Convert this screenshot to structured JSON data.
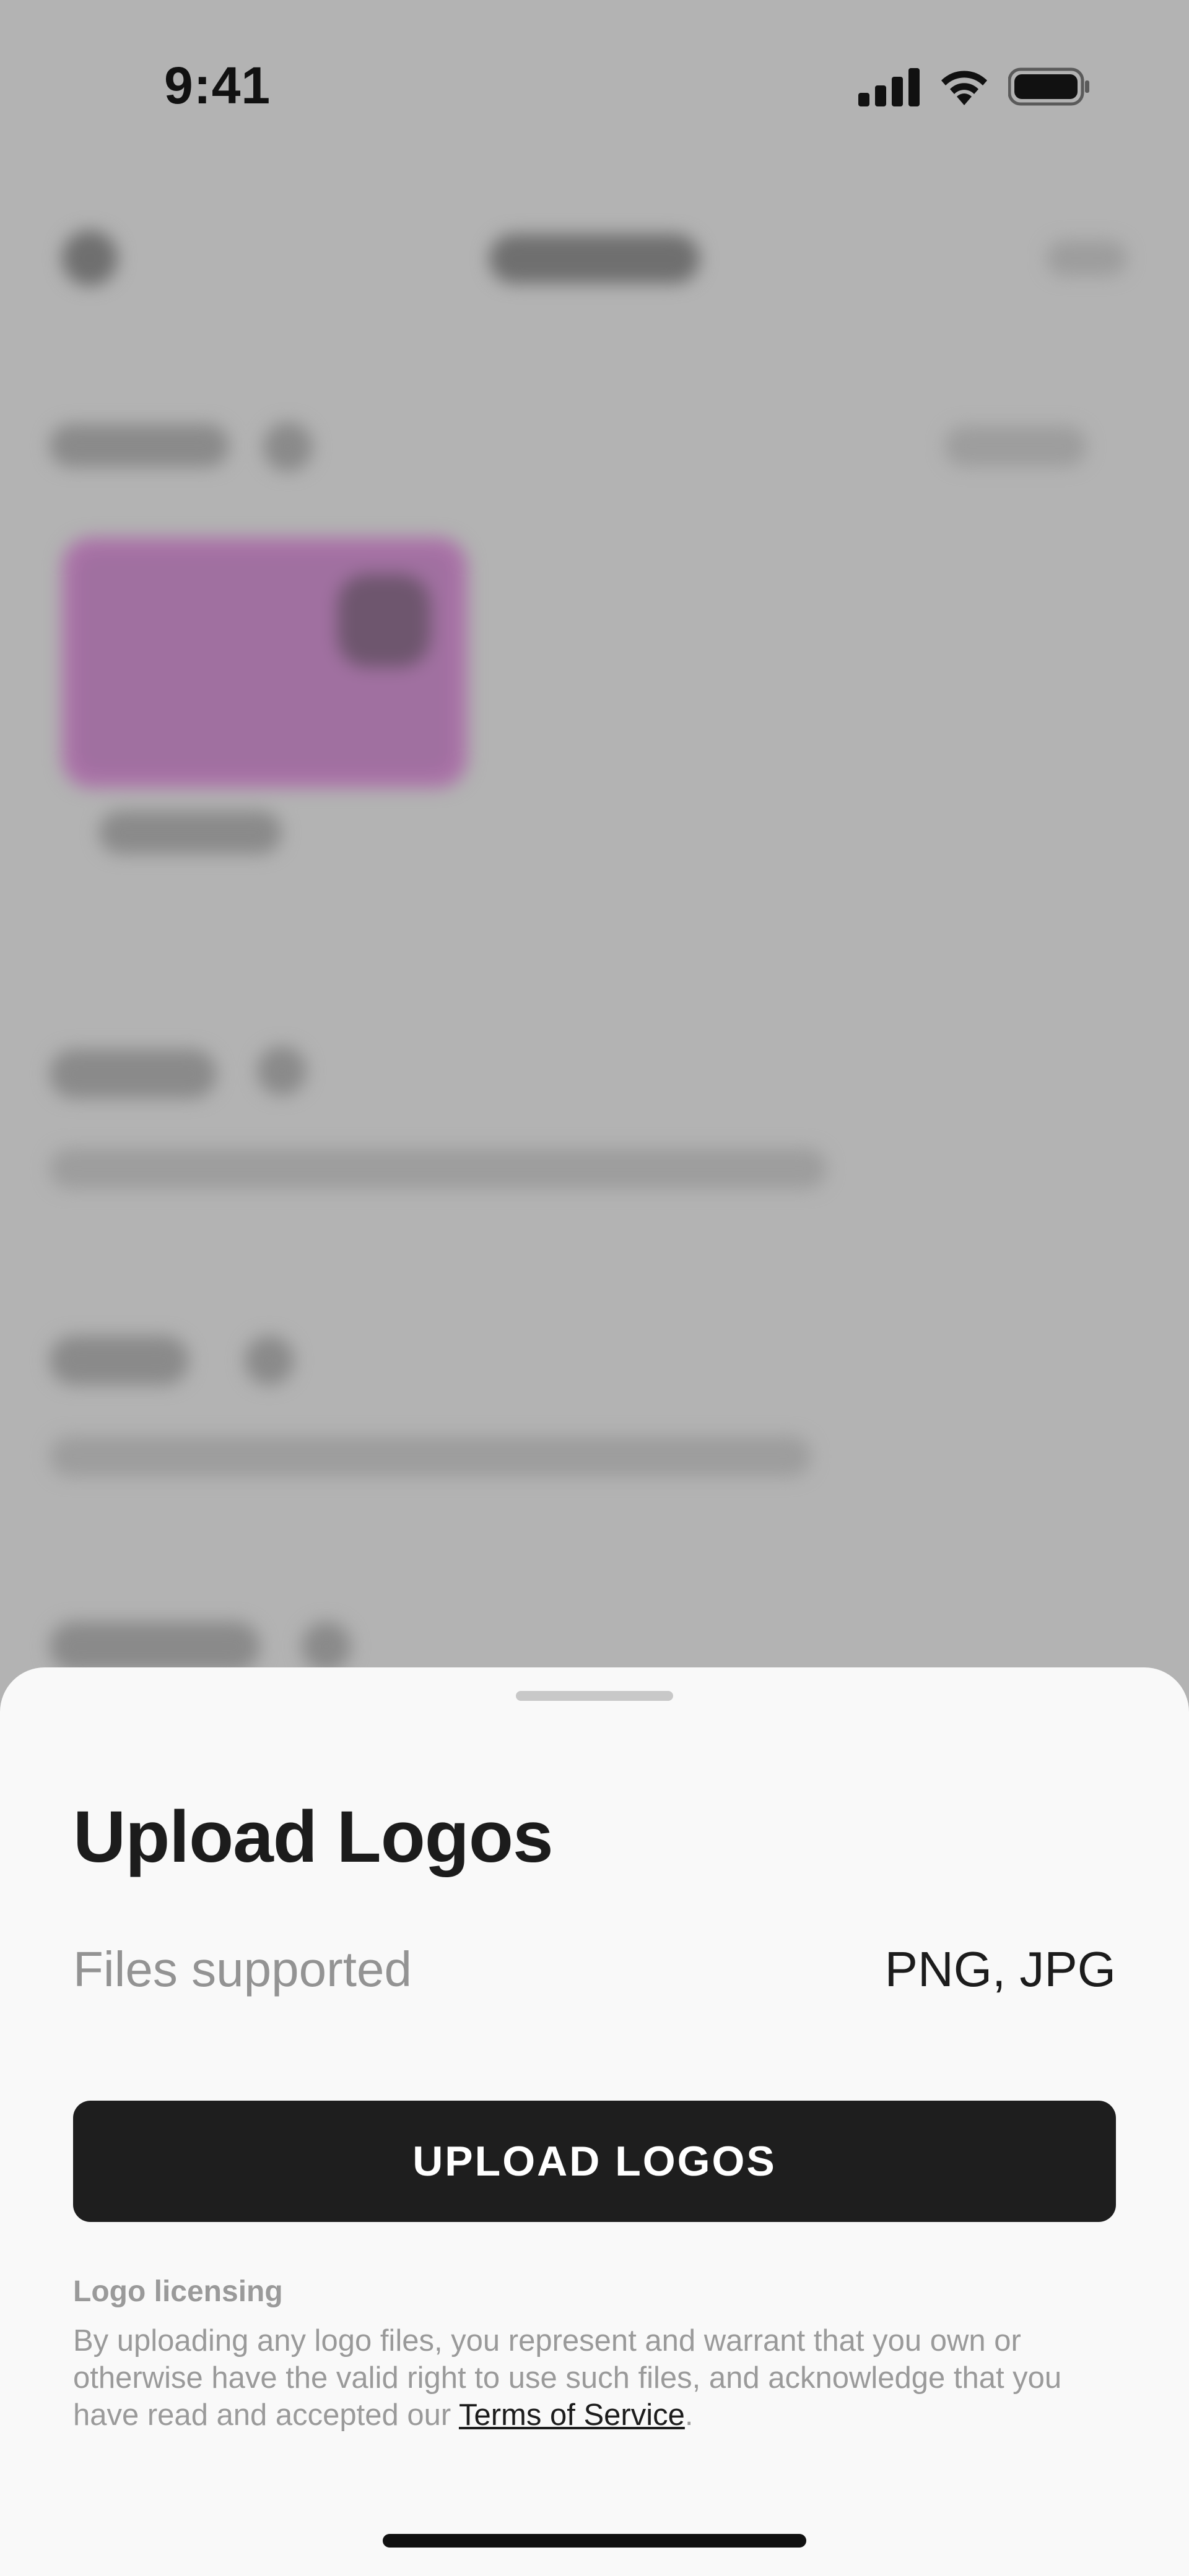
{
  "status_bar": {
    "time": "9:41",
    "icons": [
      "cellular-signal-icon",
      "wifi-icon",
      "battery-icon"
    ]
  },
  "background_sections": {
    "colors_section": {
      "swatch_color": "#ab72a8"
    }
  },
  "sheet": {
    "title": "Upload Logos",
    "files_supported_label": "Files supported",
    "files_supported_value": "PNG, JPG",
    "upload_button_label": "UPLOAD LOGOS",
    "licensing_heading": "Logo licensing",
    "licensing_text": "By uploading any logo files, you represent and warrant that you own or otherwise have the valid right to use such files, and acknowledge that you have read and accepted our ",
    "terms_link": "Terms of Service",
    "licensing_end": "."
  },
  "colors": {
    "overlay": "#b3b3b3",
    "sheet_bg": "#f9f9f9",
    "button_bg": "#1e1e1e",
    "button_text": "#ffffff",
    "muted_text": "#939393"
  }
}
